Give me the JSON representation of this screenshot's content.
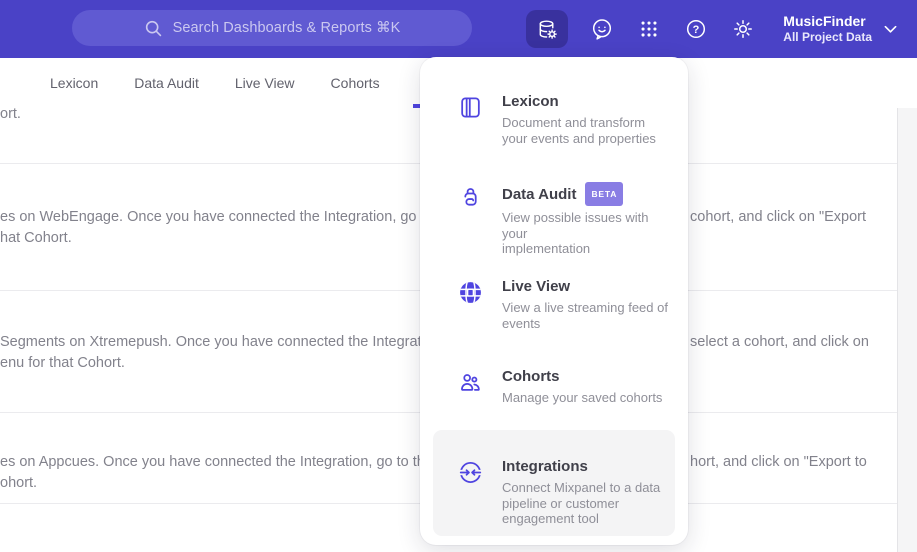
{
  "colors": {
    "header_bg": "#4a42c6",
    "search_bg": "#605ad2",
    "active_icon_bg": "#39319e",
    "accent": "#4f44e0",
    "badge_bg": "#897de4",
    "highlight_bg": "#f4f4f5"
  },
  "header": {
    "search_placeholder": "Search Dashboards & Reports ⌘K",
    "project_name": "MusicFinder",
    "project_subtitle": "All Project Data"
  },
  "glyphs": {
    "help": "?"
  },
  "tabs": [
    {
      "label": "Lexicon"
    },
    {
      "label": "Data Audit"
    },
    {
      "label": "Live View"
    },
    {
      "label": "Cohorts"
    }
  ],
  "menu": {
    "items": [
      {
        "title": "Lexicon",
        "description": "Document and transform\nyour events and properties"
      },
      {
        "title": "Data Audit",
        "badge": "BETA",
        "description": "View possible issues with your\nimplementation"
      },
      {
        "title": "Live View",
        "description": "View a live streaming feed of\nevents"
      },
      {
        "title": "Cohorts",
        "description": "Manage your saved cohorts"
      },
      {
        "title": "Integrations",
        "description": "Connect Mixpanel to a data\npipeline or customer\nengagement tool"
      }
    ]
  },
  "background": {
    "row1": {
      "left1": "ort."
    },
    "row2": {
      "left1": "es on WebEngage. Once you have connected the Integration, go to the",
      "left2": "hat Cohort.",
      "right1": "cohort, and click on \"Export"
    },
    "row3": {
      "left1": "Segments on Xtremepush. Once you have connected the Integration,",
      "left2": "enu for that Cohort.",
      "right1": "select a cohort, and click on"
    },
    "row4": {
      "left1": "es on Appcues. Once you have connected the Integration, go to the M",
      "left2": "ohort.",
      "right1": "hort, and click on \"Export to"
    }
  }
}
